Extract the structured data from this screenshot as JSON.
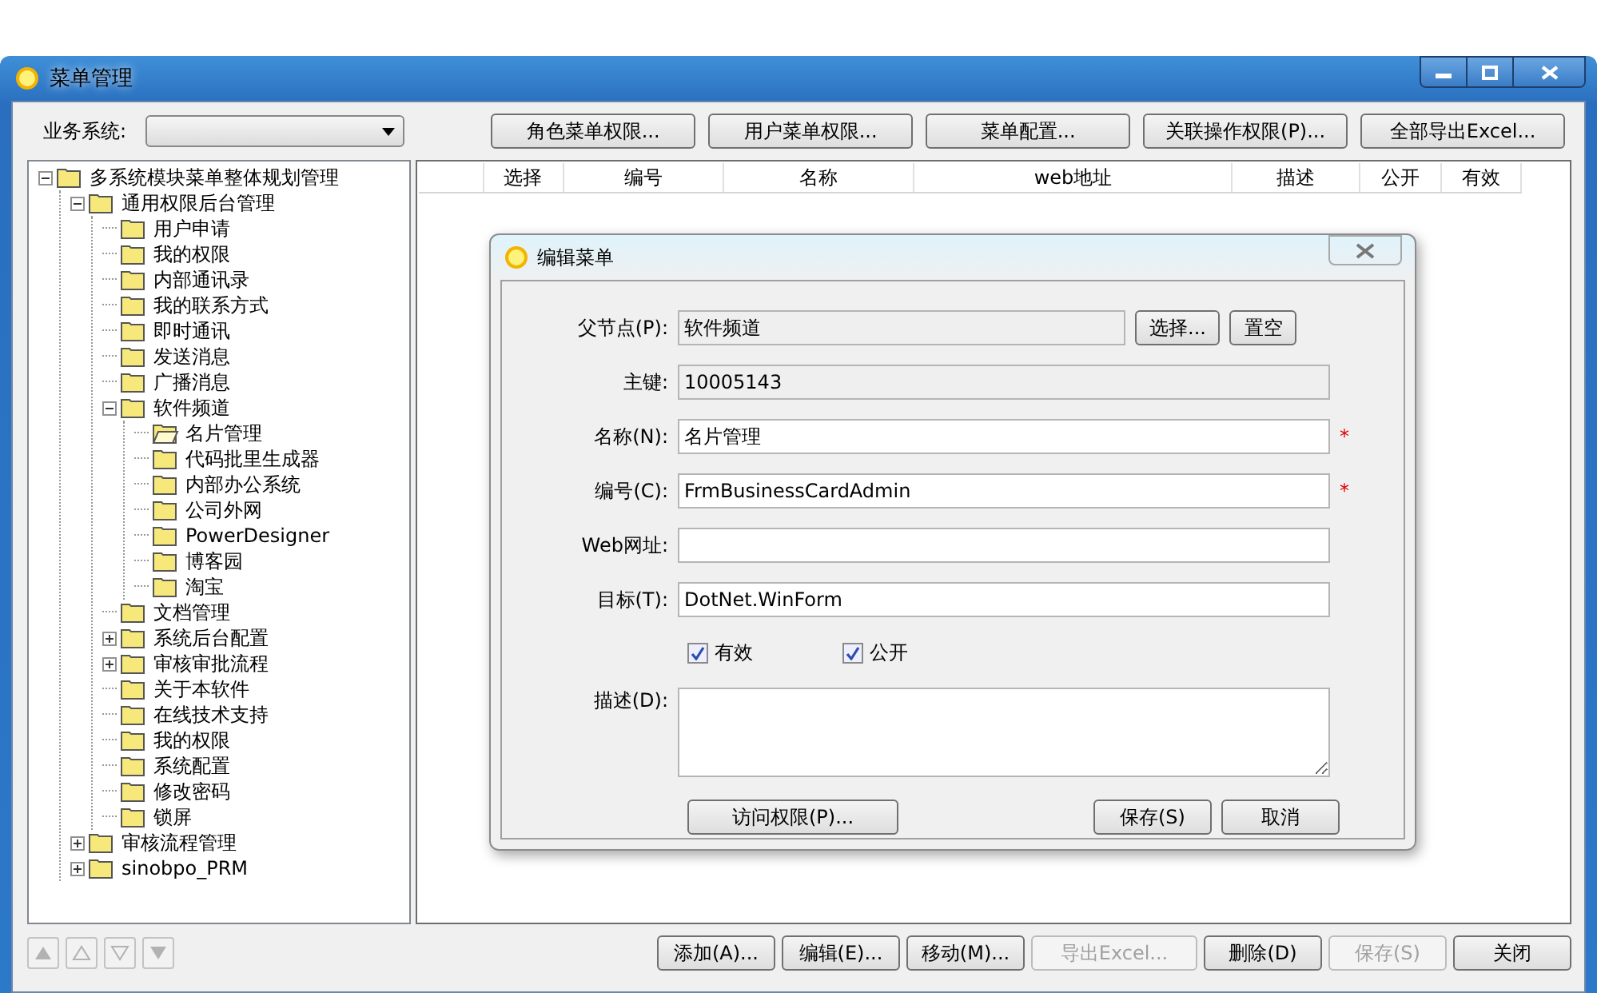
{
  "window": {
    "title": "菜单管理"
  },
  "toolbar": {
    "system_label": "业务系统:",
    "buttons": [
      {
        "label": "角色菜单权限...",
        "disabled": false
      },
      {
        "label": "用户菜单权限...",
        "disabled": false
      },
      {
        "label": "菜单配置...",
        "disabled": false
      },
      {
        "label": "关联操作权限(P)...",
        "disabled": false
      },
      {
        "label": "全部导出Excel...",
        "disabled": false
      }
    ]
  },
  "tree": [
    {
      "label": "多系统模块菜单整体规划管理",
      "selected": false,
      "expanded": true,
      "children": [
        {
          "label": "通用权限后台管理",
          "selected": false,
          "expanded": true,
          "children": [
            {
              "label": "用户申请",
              "selected": false
            },
            {
              "label": "我的权限",
              "selected": false
            },
            {
              "label": "内部通讯录",
              "selected": false
            },
            {
              "label": "我的联系方式",
              "selected": false
            },
            {
              "label": "即时通讯",
              "selected": false
            },
            {
              "label": "发送消息",
              "selected": false
            },
            {
              "label": "广播消息",
              "selected": false
            },
            {
              "label": "软件频道",
              "selected": false,
              "expanded": true,
              "children": [
                {
                  "label": "名片管理",
                  "selected": true
                },
                {
                  "label": "代码批里生成器",
                  "selected": false
                },
                {
                  "label": "内部办公系统",
                  "selected": false
                },
                {
                  "label": "公司外网",
                  "selected": false
                },
                {
                  "label": "PowerDesigner",
                  "selected": false
                },
                {
                  "label": "博客园",
                  "selected": false
                },
                {
                  "label": "淘宝",
                  "selected": false
                }
              ]
            },
            {
              "label": "文档管理",
              "selected": false
            },
            {
              "label": "系统后台配置",
              "selected": false,
              "expanded": false
            },
            {
              "label": "审核审批流程",
              "selected": false,
              "expanded": false
            },
            {
              "label": "关于本软件",
              "selected": false
            },
            {
              "label": "在线技术支持",
              "selected": false
            },
            {
              "label": "我的权限",
              "selected": false
            },
            {
              "label": "系统配置",
              "selected": false
            },
            {
              "label": "修改密码",
              "selected": false
            },
            {
              "label": "锁屏",
              "selected": false
            }
          ]
        },
        {
          "label": "审核流程管理",
          "selected": false,
          "expanded": false
        },
        {
          "label": "sinobpo_PRM",
          "selected": false,
          "expanded": false
        }
      ]
    }
  ],
  "table": {
    "columns": [
      "选择",
      "编号",
      "名称",
      "web地址",
      "描述",
      "公开",
      "有效"
    ]
  },
  "dialog": {
    "title": "编辑菜单",
    "fields": [
      {
        "kind": "text",
        "label": "父节点(P):",
        "value": "软件频道",
        "readonly": true,
        "required": false,
        "buttons": [
          "选择...",
          "置空"
        ]
      },
      {
        "kind": "text",
        "label": "主键:",
        "value": "10005143",
        "readonly": true,
        "required": false
      },
      {
        "kind": "text",
        "label": "名称(N):",
        "value": "名片管理",
        "readonly": false,
        "required": true
      },
      {
        "kind": "text",
        "label": "编号(C):",
        "value": "FrmBusinessCardAdmin",
        "readonly": false,
        "required": true
      },
      {
        "kind": "text",
        "label": "Web网址:",
        "readonly": false,
        "required": false
      },
      {
        "kind": "text",
        "label": "目标(T):",
        "value": "DotNet.WinForm",
        "readonly": false,
        "required": false
      },
      {
        "kind": "checks",
        "items": [
          {
            "label": "有效",
            "checked": true
          },
          {
            "label": "公开",
            "checked": true
          }
        ]
      },
      {
        "kind": "area",
        "label": "描述(D):",
        "readonly": false,
        "required": false
      }
    ],
    "required_mark": "*",
    "left_button": "访问权限(P)...",
    "buttons": [
      "保存(S)",
      "取消"
    ]
  },
  "bottom": {
    "nav": [
      {
        "kind": "first",
        "disabled": true
      },
      {
        "kind": "up",
        "disabled": true
      },
      {
        "kind": "down",
        "disabled": true
      },
      {
        "kind": "last",
        "disabled": true
      }
    ],
    "buttons": [
      {
        "label": "添加(A)...",
        "disabled": false
      },
      {
        "label": "编辑(E)...",
        "disabled": false
      },
      {
        "label": "移动(M)...",
        "disabled": false
      },
      {
        "label": "导出Excel...",
        "disabled": true
      },
      {
        "label": "删除(D)",
        "disabled": false
      },
      {
        "label": "保存(S)",
        "disabled": true
      },
      {
        "label": "关闭",
        "disabled": false
      }
    ]
  }
}
